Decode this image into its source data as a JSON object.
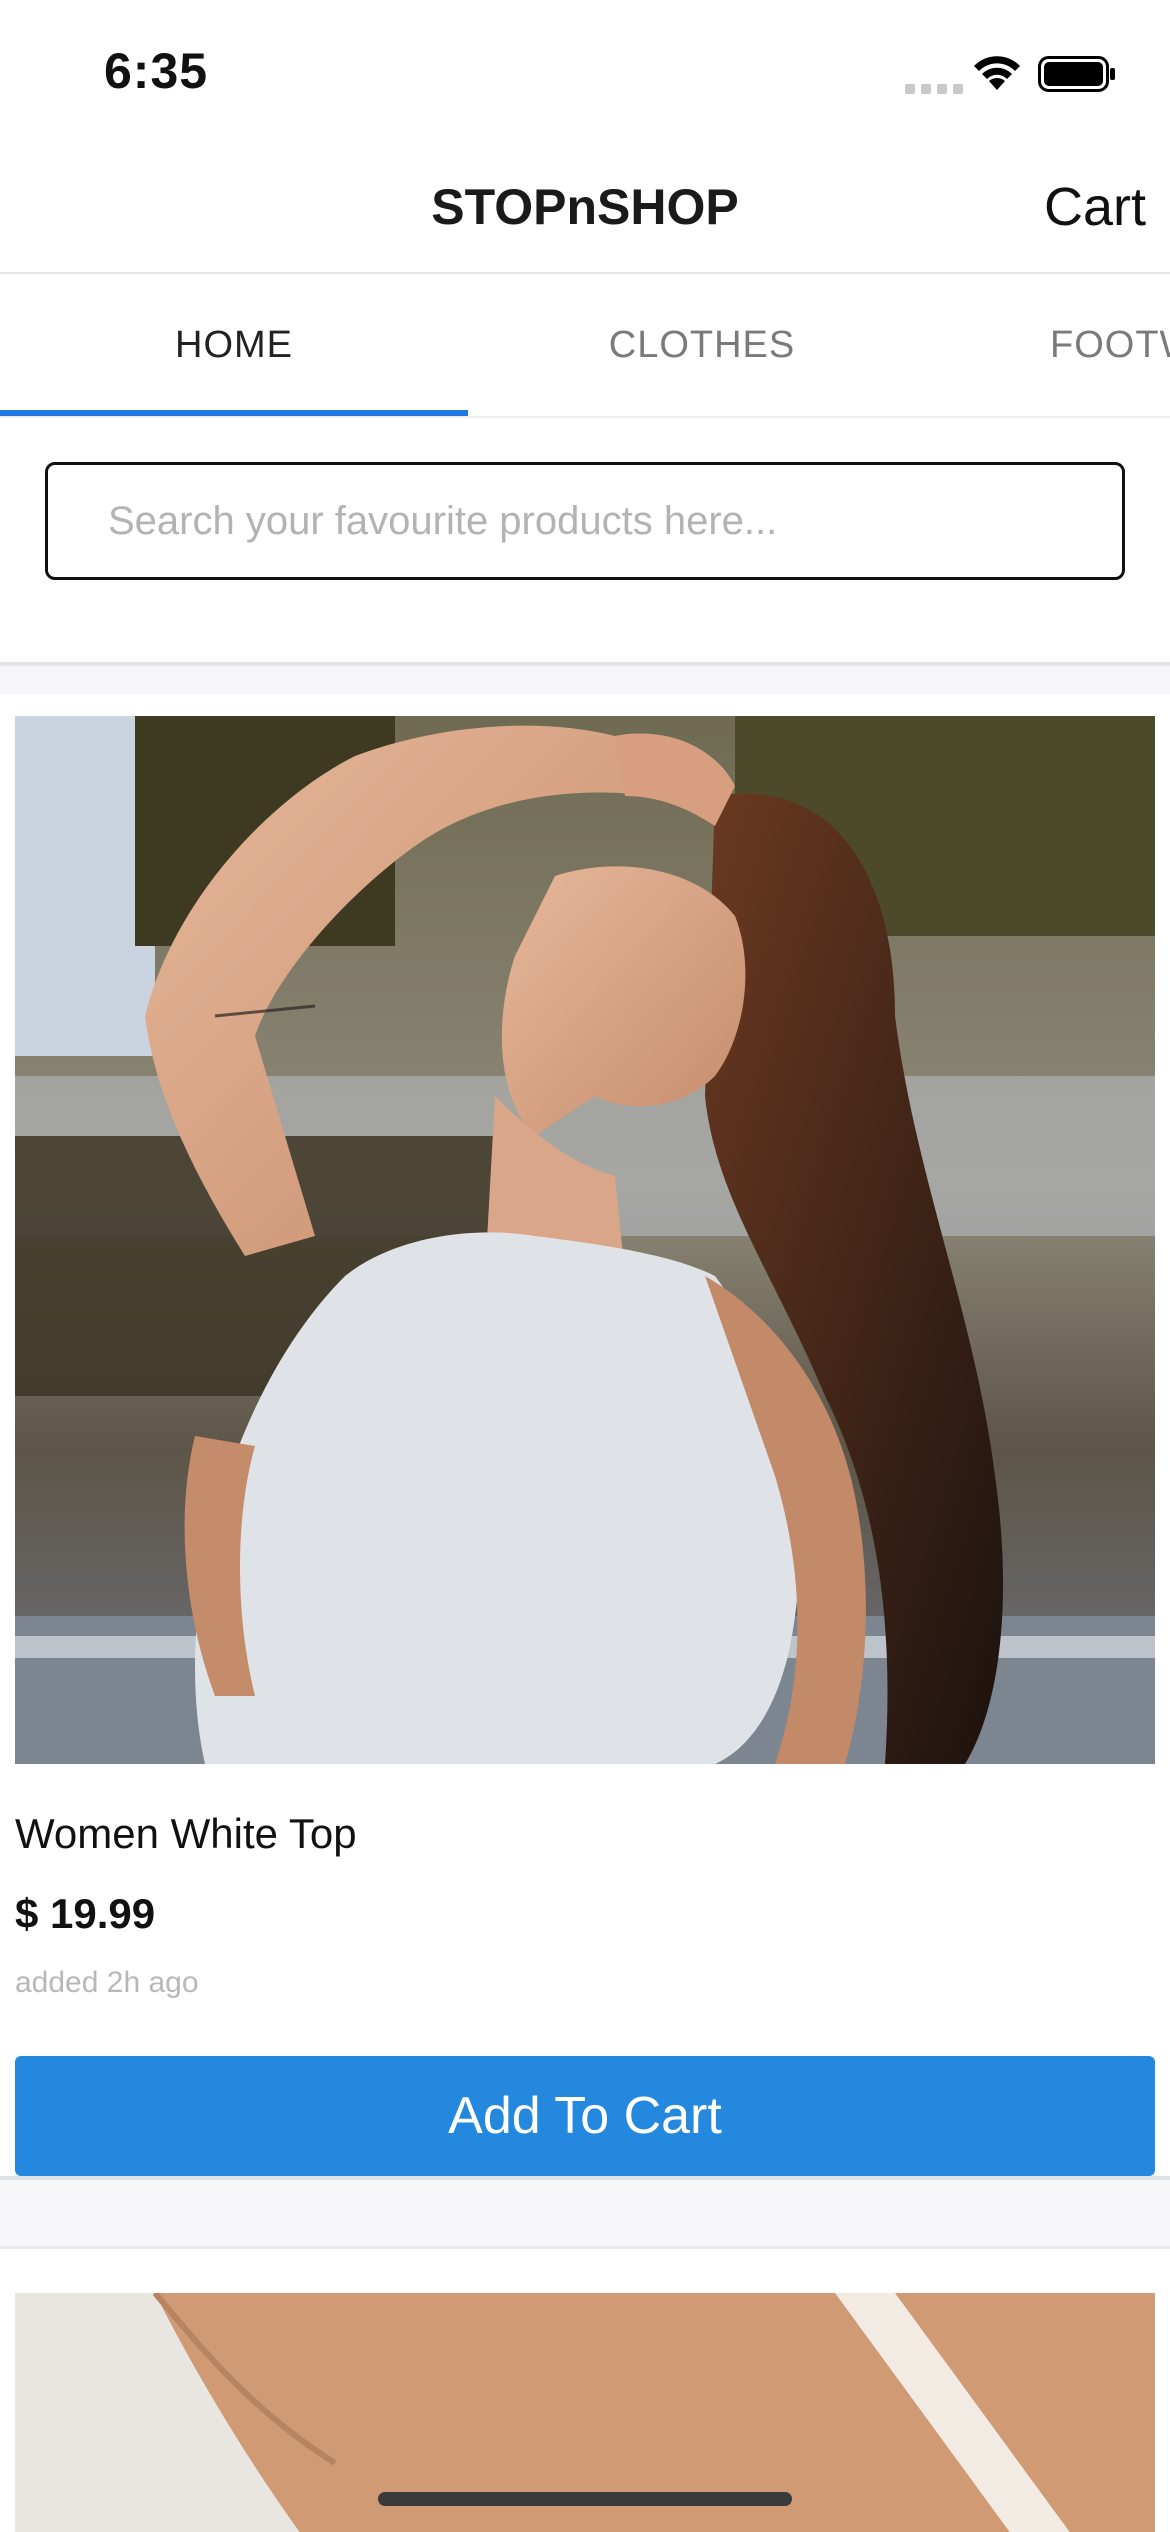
{
  "status_bar": {
    "time": "6:35",
    "icons": [
      "cellular-signal-icon",
      "wifi-icon",
      "battery-icon"
    ]
  },
  "header": {
    "title": "STOPnSHOP",
    "cart_label": "Cart"
  },
  "tabs": [
    {
      "label": "HOME",
      "active": true
    },
    {
      "label": "CLOTHES",
      "active": false
    },
    {
      "label": "FOOTWEAR",
      "active": false
    }
  ],
  "search": {
    "placeholder": "Search your favourite products here...",
    "value": ""
  },
  "products": [
    {
      "name": "Women White Top",
      "price": "$ 19.99",
      "added": "added 2h ago",
      "button_label": "Add To Cart"
    }
  ],
  "colors": {
    "accent": "#1f7ae0",
    "button": "#2388de",
    "placeholder": "#b3b3b3"
  }
}
